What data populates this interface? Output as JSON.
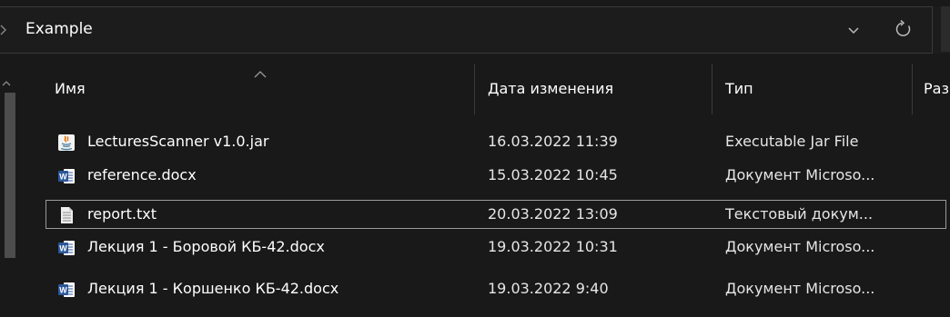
{
  "address_bar": {
    "path": "Example"
  },
  "columns": {
    "name": "Имя",
    "date": "Дата изменения",
    "type": "Тип",
    "size": "Раз"
  },
  "files": [
    {
      "name": "LecturesScanner v1.0.jar",
      "date": "16.03.2022 11:39",
      "type": "Executable Jar File",
      "icon": "java-jar-icon"
    },
    {
      "name": "reference.docx",
      "date": "15.03.2022 10:45",
      "type": "Документ Microso...",
      "icon": "word-document-icon"
    },
    {
      "name": "report.txt",
      "date": "20.03.2022 13:09",
      "type": "Текстовый докум...",
      "icon": "text-document-icon"
    },
    {
      "name": "Лекция 1 - Боровой КБ-42.docx",
      "date": "19.03.2022 10:31",
      "type": "Документ Microso...",
      "icon": "word-document-icon"
    },
    {
      "name": "Лекция 1 - Коршенко КБ-42.docx",
      "date": "19.03.2022 9:40",
      "type": "Документ Microso...",
      "icon": "word-document-icon"
    }
  ],
  "selected_index": 2,
  "colors": {
    "background": "#191919",
    "word_blue": "#2b579a",
    "java_orange": "#e76f00",
    "java_blue": "#5382a1"
  }
}
